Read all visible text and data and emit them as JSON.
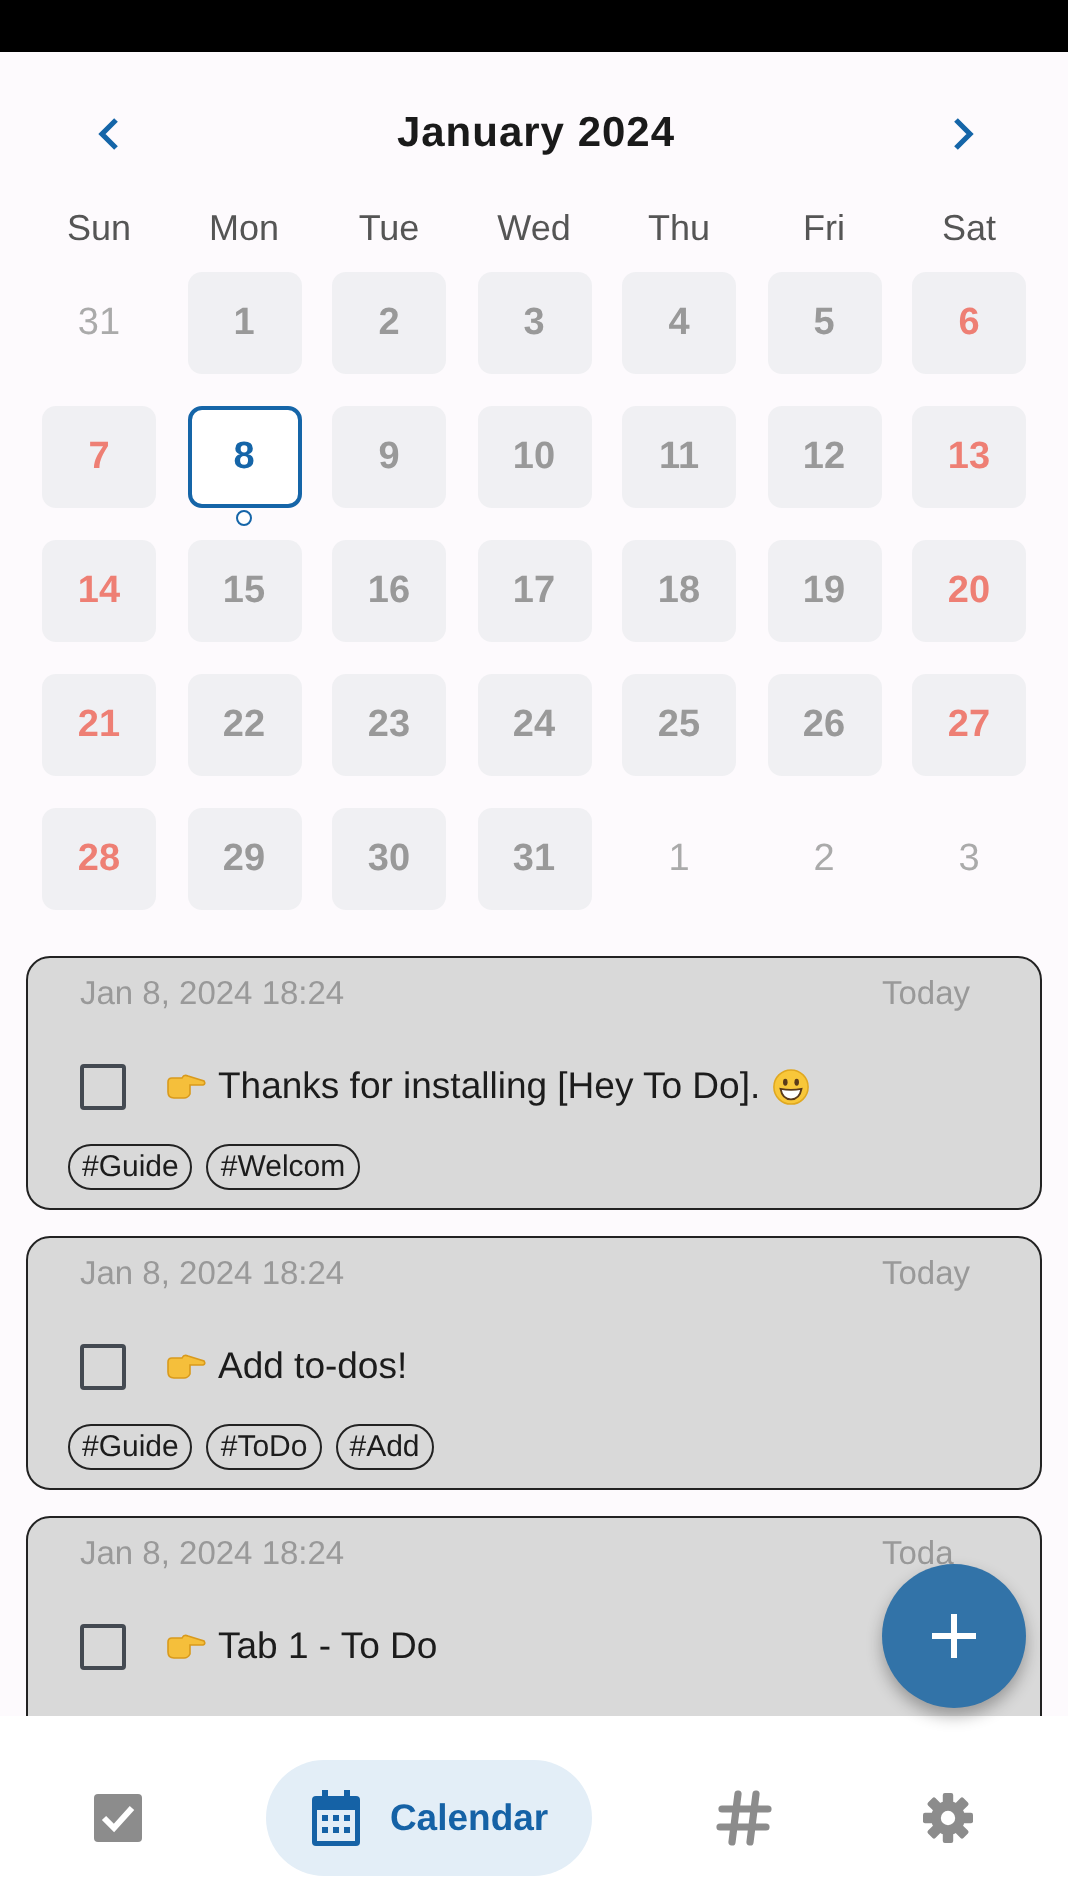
{
  "calendar": {
    "title": "January 2024",
    "weekdays": [
      "Sun",
      "Mon",
      "Tue",
      "Wed",
      "Thu",
      "Fri",
      "Sat"
    ],
    "days": [
      {
        "label": "31",
        "kind": "outside",
        "selected": false,
        "dot": false
      },
      {
        "label": "1",
        "kind": "weekday",
        "selected": false,
        "dot": false
      },
      {
        "label": "2",
        "kind": "weekday",
        "selected": false,
        "dot": false
      },
      {
        "label": "3",
        "kind": "weekday",
        "selected": false,
        "dot": false
      },
      {
        "label": "4",
        "kind": "weekday",
        "selected": false,
        "dot": false
      },
      {
        "label": "5",
        "kind": "weekday",
        "selected": false,
        "dot": false
      },
      {
        "label": "6",
        "kind": "weekend",
        "selected": false,
        "dot": false
      },
      {
        "label": "7",
        "kind": "weekend",
        "selected": false,
        "dot": false
      },
      {
        "label": "8",
        "kind": "weekday",
        "selected": true,
        "dot": true
      },
      {
        "label": "9",
        "kind": "weekday",
        "selected": false,
        "dot": false
      },
      {
        "label": "10",
        "kind": "weekday",
        "selected": false,
        "dot": false
      },
      {
        "label": "11",
        "kind": "weekday",
        "selected": false,
        "dot": false
      },
      {
        "label": "12",
        "kind": "weekday",
        "selected": false,
        "dot": false
      },
      {
        "label": "13",
        "kind": "weekend",
        "selected": false,
        "dot": false
      },
      {
        "label": "14",
        "kind": "weekend",
        "selected": false,
        "dot": false
      },
      {
        "label": "15",
        "kind": "weekday",
        "selected": false,
        "dot": false
      },
      {
        "label": "16",
        "kind": "weekday",
        "selected": false,
        "dot": false
      },
      {
        "label": "17",
        "kind": "weekday",
        "selected": false,
        "dot": false
      },
      {
        "label": "18",
        "kind": "weekday",
        "selected": false,
        "dot": false
      },
      {
        "label": "19",
        "kind": "weekday",
        "selected": false,
        "dot": false
      },
      {
        "label": "20",
        "kind": "weekend",
        "selected": false,
        "dot": false
      },
      {
        "label": "21",
        "kind": "weekend",
        "selected": false,
        "dot": false
      },
      {
        "label": "22",
        "kind": "weekday",
        "selected": false,
        "dot": false
      },
      {
        "label": "23",
        "kind": "weekday",
        "selected": false,
        "dot": false
      },
      {
        "label": "24",
        "kind": "weekday",
        "selected": false,
        "dot": false
      },
      {
        "label": "25",
        "kind": "weekday",
        "selected": false,
        "dot": false
      },
      {
        "label": "26",
        "kind": "weekday",
        "selected": false,
        "dot": false
      },
      {
        "label": "27",
        "kind": "weekend",
        "selected": false,
        "dot": false
      },
      {
        "label": "28",
        "kind": "weekend",
        "selected": false,
        "dot": false
      },
      {
        "label": "29",
        "kind": "weekday",
        "selected": false,
        "dot": false
      },
      {
        "label": "30",
        "kind": "weekday",
        "selected": false,
        "dot": false
      },
      {
        "label": "31",
        "kind": "weekday",
        "selected": false,
        "dot": false
      },
      {
        "label": "1",
        "kind": "outside",
        "selected": false,
        "dot": false
      },
      {
        "label": "2",
        "kind": "outside",
        "selected": false,
        "dot": false
      },
      {
        "label": "3",
        "kind": "outside",
        "selected": false,
        "dot": false
      }
    ]
  },
  "todos": [
    {
      "date": "Jan 8, 2024 18:24",
      "due": "Today",
      "checked": false,
      "text": "Thanks for installing [Hey To Do].",
      "grinning_emoji": true,
      "tags": [
        "#Guide",
        "#Welcom"
      ]
    },
    {
      "date": "Jan 8, 2024 18:24",
      "due": "Today",
      "checked": false,
      "text": "Add to-dos!",
      "grinning_emoji": false,
      "tags": [
        "#Guide",
        "#ToDo",
        "#Add"
      ]
    },
    {
      "date": "Jan 8, 2024 18:24",
      "due": "Toda",
      "checked": false,
      "text": "Tab 1 - To Do",
      "grinning_emoji": false
    }
  ],
  "nav": [
    {
      "kind": "todos",
      "selected": false
    },
    {
      "kind": "calendar",
      "label": "Calendar",
      "selected": true
    },
    {
      "kind": "tags",
      "selected": false
    },
    {
      "kind": "settings",
      "selected": false
    }
  ]
}
